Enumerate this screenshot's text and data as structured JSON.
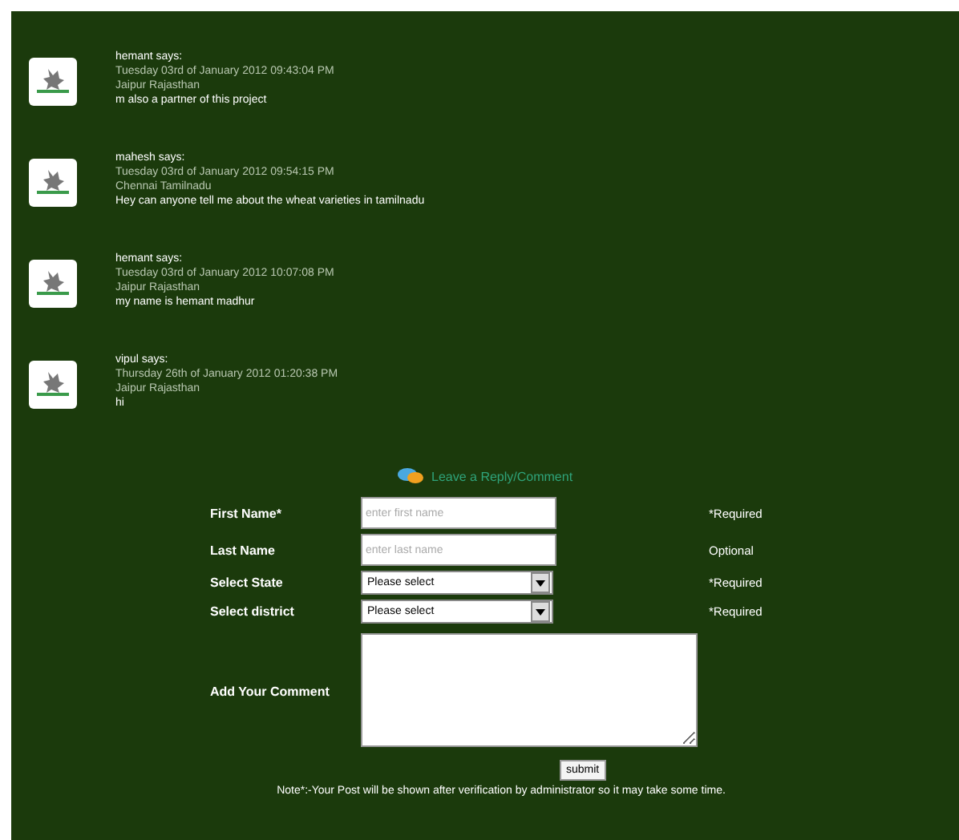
{
  "comments": [
    {
      "author": "hemant says:",
      "date": "Tuesday 03rd of January 2012 09:43:04 PM",
      "location": "Jaipur Rajasthan",
      "text": "m also a partner of this project"
    },
    {
      "author": "mahesh says:",
      "date": "Tuesday 03rd of January 2012 09:54:15 PM",
      "location": "Chennai Tamilnadu",
      "text": "Hey can anyone tell me about the wheat varieties in tamilnadu"
    },
    {
      "author": "hemant says:",
      "date": "Tuesday 03rd of January 2012 10:07:08 PM",
      "location": "Jaipur Rajasthan",
      "text": "my name is hemant madhur"
    },
    {
      "author": "vipul says:",
      "date": "Thursday 26th of January 2012 01:20:38 PM",
      "location": "Jaipur Rajasthan",
      "text": "hi"
    }
  ],
  "reply_form": {
    "heading": "Leave a Reply/Comment",
    "fields": [
      {
        "kind": "text",
        "label": "First Name*",
        "placeholder": "enter first name",
        "hint": "*Required"
      },
      {
        "kind": "text",
        "label": "Last Name",
        "placeholder": "enter last name",
        "hint": "Optional"
      },
      {
        "kind": "select",
        "label": "Select State",
        "value": "Please select",
        "hint": "*Required"
      },
      {
        "kind": "select",
        "label": "Select district",
        "value": "Please select",
        "hint": "*Required"
      },
      {
        "kind": "textarea",
        "label": "Add Your Comment"
      }
    ],
    "submit": "submit",
    "note": "Note*:-Your Post will be shown after verification by administrator so it may take some time."
  }
}
